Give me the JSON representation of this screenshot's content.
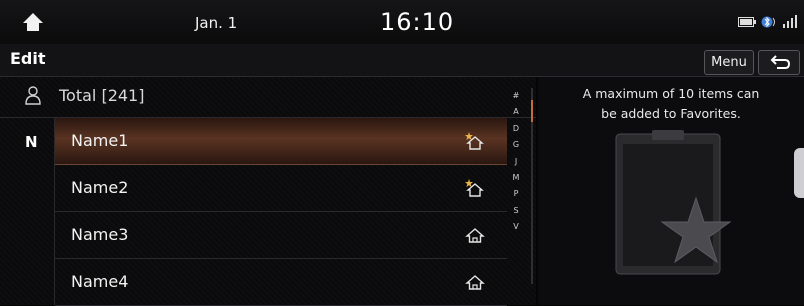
{
  "status": {
    "date": "Jan. 1",
    "time": "16:10",
    "icons": [
      "home-icon",
      "battery-icon",
      "bluetooth-phone-icon",
      "signal-icon"
    ]
  },
  "header": {
    "title": "Edit",
    "menu_label": "Menu"
  },
  "contacts": {
    "total_label": "Total [241]",
    "group_letter": "N",
    "rows": [
      {
        "name": "Name1",
        "favorite": true,
        "selected": true
      },
      {
        "name": "Name2",
        "favorite": true,
        "selected": false
      },
      {
        "name": "Name3",
        "favorite": false,
        "selected": false
      },
      {
        "name": "Name4",
        "favorite": false,
        "selected": false
      }
    ],
    "index_letters": [
      "#",
      "A",
      "D",
      "G",
      "J",
      "M",
      "P",
      "S",
      "V"
    ]
  },
  "info": {
    "message_line1": "A maximum of 10 items can",
    "message_line2": "be added to Favorites."
  },
  "colors": {
    "accent": "#c26b3c",
    "selected_row": "#5a3322",
    "favorite_star": "#e8b24a"
  }
}
